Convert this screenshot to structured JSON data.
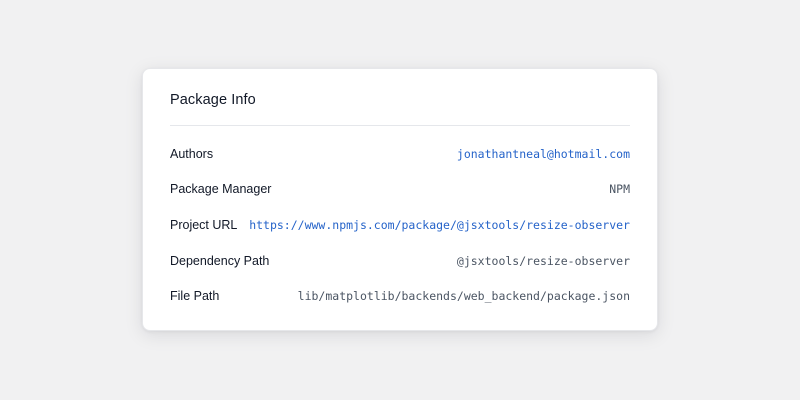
{
  "card": {
    "title": "Package Info",
    "rows": [
      {
        "label": "Authors",
        "value": "jonathantneal@hotmail.com"
      },
      {
        "label": "Package Manager",
        "value": "NPM"
      },
      {
        "label": "Project URL",
        "value": "https://www.npmjs.com/package/@jsxtools/resize-observer"
      },
      {
        "label": "Dependency Path",
        "value": "@jsxtools/resize-observer"
      },
      {
        "label": "File Path",
        "value": "lib/matplotlib/backends/web_backend/package.json"
      }
    ]
  },
  "colors": {
    "background": "#f1f1f2",
    "card": "#ffffff",
    "link": "#2563c9",
    "text": "#111827",
    "muted": "#4b5563"
  }
}
